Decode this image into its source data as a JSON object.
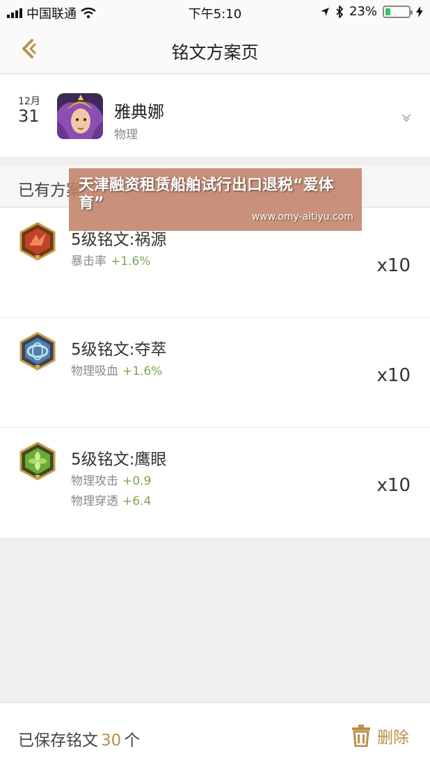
{
  "status_bar": {
    "carrier": "中国联通",
    "time": "下午5:10",
    "battery": "23%",
    "battery_level": 0.23
  },
  "nav": {
    "title": "铭文方案页"
  },
  "hero": {
    "month": "12月",
    "day": "31",
    "name": "雅典娜",
    "type": "物理"
  },
  "section": {
    "label": "已有方案"
  },
  "runes": [
    {
      "name": "5级铭文:祸源",
      "icon": "rune-red-icon",
      "attrs": [
        {
          "label": "暴击率",
          "value": "+1.6%"
        }
      ],
      "count": "x10"
    },
    {
      "name": "5级铭文:夺萃",
      "icon": "rune-blue-icon",
      "attrs": [
        {
          "label": "物理吸血",
          "value": "+1.6%"
        }
      ],
      "count": "x10"
    },
    {
      "name": "5级铭文:鹰眼",
      "icon": "rune-green-icon",
      "attrs": [
        {
          "label": "物理攻击",
          "value": "+0.9"
        },
        {
          "label": "物理穿透",
          "value": "+6.4"
        }
      ],
      "count": "x10"
    }
  ],
  "watermark": {
    "title": "天津融资租赁船舶试行出口退税“爱体育”",
    "url": "www.omy-aitiyu.com"
  },
  "footer": {
    "saved_prefix": "已保存铭文",
    "saved_count": "30",
    "saved_suffix": "个",
    "delete_label": "删除"
  },
  "colors": {
    "accent_gold": "#b88f4c",
    "attr_green": "#7aa652",
    "watermark_bg": "#c18268"
  }
}
